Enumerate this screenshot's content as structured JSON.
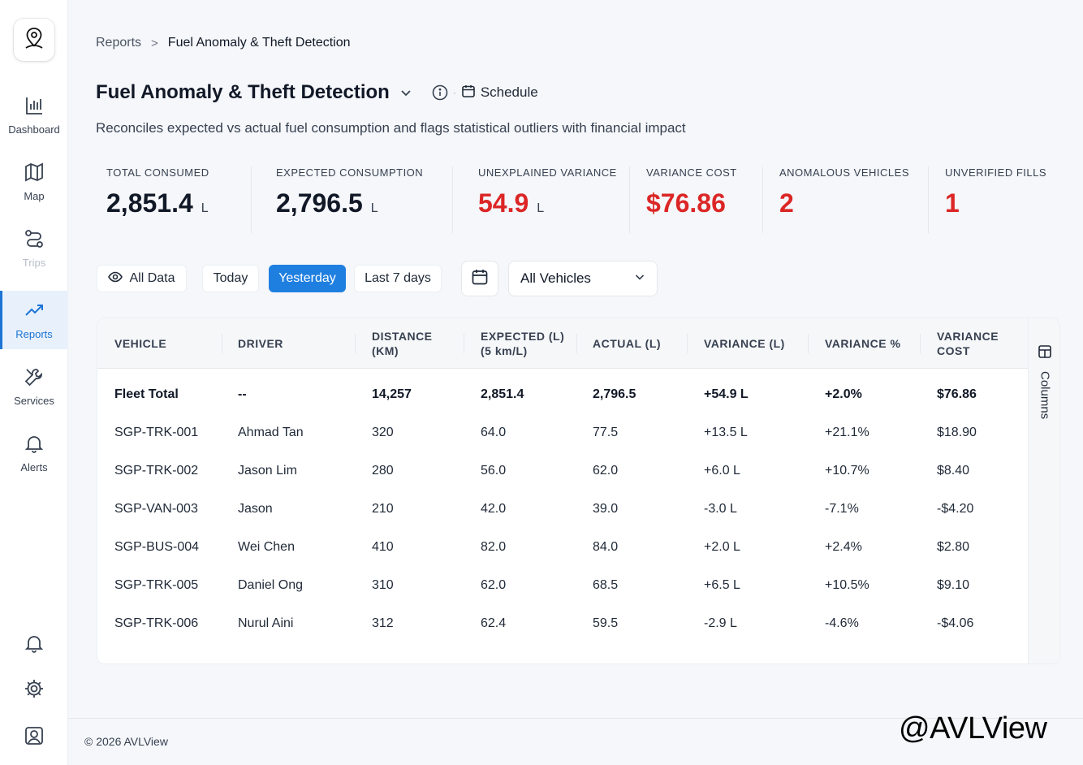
{
  "sidebar": {
    "items": [
      {
        "label": "Dashboard",
        "icon": "bar-chart-icon"
      },
      {
        "label": "Map",
        "icon": "map-icon"
      },
      {
        "label": "Trips",
        "icon": "route-icon"
      },
      {
        "label": "Reports",
        "icon": "trending-up-icon",
        "active": true
      },
      {
        "label": "Services",
        "icon": "wrench-icon"
      },
      {
        "label": "Alerts",
        "icon": "bell-icon"
      }
    ],
    "bottom_icons": [
      "notification-bell-icon",
      "settings-gear-icon",
      "user-profile-icon"
    ]
  },
  "breadcrumb": {
    "parent": "Reports",
    "separator": ">",
    "current": "Fuel Anomaly & Theft Detection"
  },
  "header": {
    "title": "Fuel Anomaly & Theft Detection",
    "schedule_label": "Schedule",
    "dot": "·",
    "subtitle": "Reconciles expected vs actual fuel consumption and flags statistical outliers with financial impact"
  },
  "kpis": [
    {
      "label": "TOTAL CONSUMED",
      "value": "2,851.4",
      "unit": "L",
      "color": "#111827"
    },
    {
      "label": "EXPECTED CONSUMPTION",
      "value": "2,796.5",
      "unit": "L",
      "color": "#111827"
    },
    {
      "label": "UNEXPLAINED VARIANCE",
      "value": "54.9",
      "unit": "L",
      "color": "#dc2626"
    },
    {
      "label": "VARIANCE COST",
      "value": "$76.86",
      "unit": "",
      "color": "#dc2626"
    },
    {
      "label": "ANOMALOUS VEHICLES",
      "value": "2",
      "unit": "",
      "color": "#dc2626"
    },
    {
      "label": "UNVERIFIED FILLS",
      "value": "1",
      "unit": "",
      "color": "#dc2626"
    }
  ],
  "filters": {
    "all_data": "All Data",
    "today": "Today",
    "yesterday": "Yesterday",
    "last7": "Last 7 days",
    "selected": "Yesterday",
    "vehicle_select": "All Vehicles"
  },
  "table": {
    "headers": {
      "vehicle": "VEHICLE",
      "driver": "DRIVER",
      "distance_1": "DISTANCE",
      "distance_2": "(KM)",
      "expected_1": "EXPECTED (L)",
      "expected_2": "(5 km/L)",
      "actual": "ACTUAL (L)",
      "variance_l": "VARIANCE (L)",
      "variance_pct": "VARIANCE %",
      "cost_1": "VARIANCE",
      "cost_2": "COST"
    },
    "total": {
      "vehicle": "Fleet Total",
      "driver": "--",
      "distance": "14,257",
      "expected": "2,851.4",
      "actual": "2,796.5",
      "variance": "+54.9 L",
      "pct": "+2.0%",
      "cost": "$76.86"
    },
    "rows": [
      {
        "vehicle": "SGP-TRK-001",
        "driver": "Ahmad Tan",
        "distance": "320",
        "expected": "64.0",
        "actual": "77.5",
        "variance": "+13.5 L",
        "pct": "+21.1%",
        "cost": "$18.90"
      },
      {
        "vehicle": "SGP-TRK-002",
        "driver": "Jason Lim",
        "distance": "280",
        "expected": "56.0",
        "actual": "62.0",
        "variance": "+6.0 L",
        "pct": "+10.7%",
        "cost": "$8.40"
      },
      {
        "vehicle": "SGP-VAN-003",
        "driver": "Jason",
        "distance": "210",
        "expected": "42.0",
        "actual": "39.0",
        "variance": "-3.0 L",
        "pct": "-7.1%",
        "cost": "-$4.20"
      },
      {
        "vehicle": "SGP-BUS-004",
        "driver": "Wei Chen",
        "distance": "410",
        "expected": "82.0",
        "actual": "84.0",
        "variance": "+2.0 L",
        "pct": "+2.4%",
        "cost": "$2.80"
      },
      {
        "vehicle": "SGP-TRK-005",
        "driver": "Daniel Ong",
        "distance": "310",
        "expected": "62.0",
        "actual": "68.5",
        "variance": "+6.5 L",
        "pct": "+10.5%",
        "cost": "$9.10"
      },
      {
        "vehicle": "SGP-TRK-006",
        "driver": "Nurul Aini",
        "distance": "312",
        "expected": "62.4",
        "actual": "59.5",
        "variance": "-2.9 L",
        "pct": "-4.6%",
        "cost": "-$4.06"
      }
    ],
    "columns_button": "Columns"
  },
  "footer": {
    "copyright": "© 2026 AVLView"
  },
  "watermark": "@AVLView",
  "colors": {
    "accent": "#1f7fe0",
    "alert": "#dc2626",
    "active_nav_bg": "#e8f1fb"
  }
}
